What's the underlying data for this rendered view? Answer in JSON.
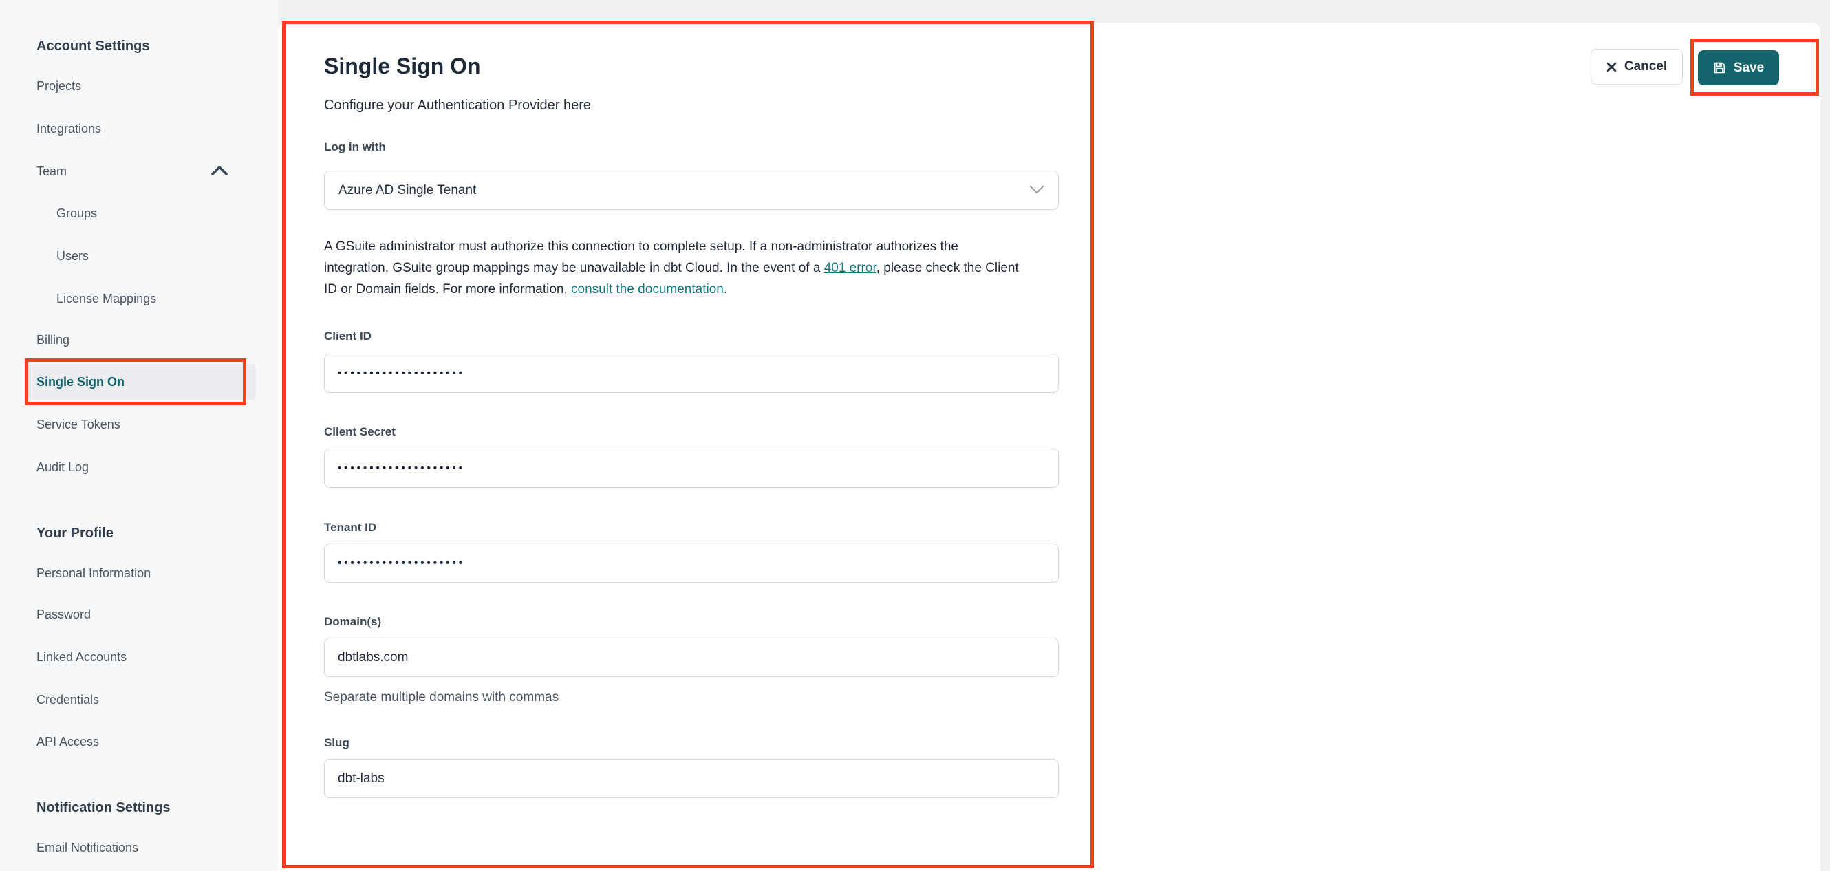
{
  "colors": {
    "accent_teal": "#15656d",
    "link_teal": "#17777e",
    "active_nav_teal": "#11616a",
    "annotation_red": "#f53f21",
    "sidebar_bg": "#f7f8fa",
    "page_bg": "#eff1f3"
  },
  "sidebar": {
    "sections": [
      {
        "header": "Account Settings",
        "items": [
          {
            "label": "Projects"
          },
          {
            "label": "Integrations"
          },
          {
            "label": "Team",
            "chevron": "up"
          },
          {
            "label": "Groups",
            "indent": true
          },
          {
            "label": "Users",
            "indent": true
          },
          {
            "label": "License Mappings",
            "indent": true
          },
          {
            "label": "Billing"
          },
          {
            "label": "Single Sign On",
            "active": true,
            "annotated": true
          },
          {
            "label": "Service Tokens"
          },
          {
            "label": "Audit Log"
          }
        ]
      },
      {
        "header": "Your Profile",
        "items": [
          {
            "label": "Personal Information"
          },
          {
            "label": "Password"
          },
          {
            "label": "Linked Accounts"
          },
          {
            "label": "Credentials"
          },
          {
            "label": "API Access"
          }
        ]
      },
      {
        "header": "Notification Settings",
        "items": [
          {
            "label": "Email Notifications"
          }
        ]
      }
    ]
  },
  "header_actions": {
    "cancel_label": "Cancel",
    "save_label": "Save"
  },
  "main": {
    "title": "Single Sign On",
    "subtitle": "Configure your Authentication Provider here",
    "login_with": {
      "label": "Log in with",
      "value": "Azure AD Single Tenant"
    },
    "notice": {
      "lines": [
        [
          {
            "text": "A GSuite administrator must authorize this connection to complete setup. If a non-administrator authorizes the"
          }
        ],
        [
          {
            "text": "integration, GSuite group mappings may be unavailable in dbt Cloud. In the event of a "
          },
          {
            "text": "401 error",
            "link": true
          },
          {
            "text": ", please check the Client"
          }
        ],
        [
          {
            "text": "ID or Domain fields. For more information, "
          },
          {
            "text": "consult the documentation",
            "link": true
          },
          {
            "text": "."
          }
        ]
      ]
    },
    "fields": [
      {
        "label": "Client ID",
        "value": "••••••••••••••••••••",
        "masked": true
      },
      {
        "label": "Client Secret",
        "value": "••••••••••••••••••••",
        "masked": true
      },
      {
        "label": "Tenant ID",
        "value": "••••••••••••••••••••",
        "masked": true
      },
      {
        "label": "Domain(s)",
        "value": "dbtlabs.com",
        "helper": "Separate multiple domains with commas"
      },
      {
        "label": "Slug",
        "value": "dbt-labs"
      }
    ]
  }
}
